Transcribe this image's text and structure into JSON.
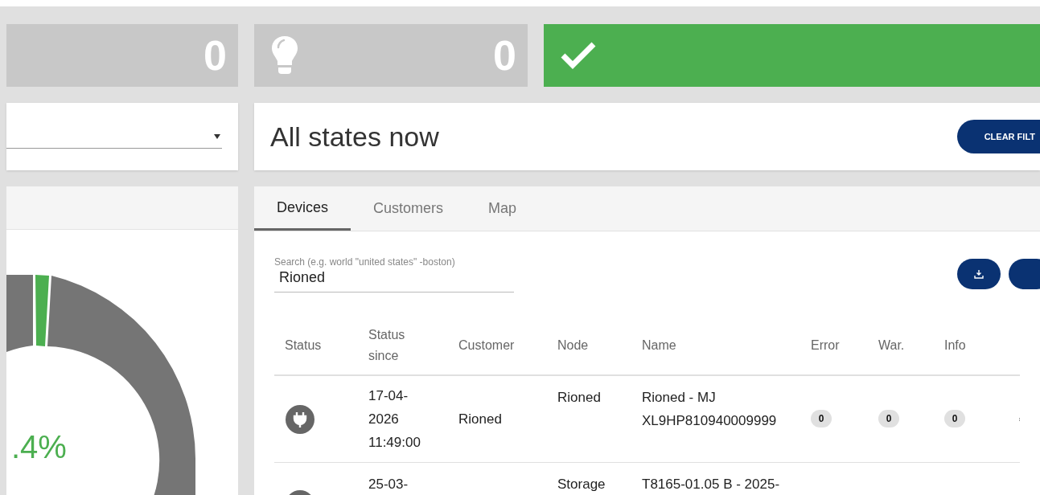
{
  "counters": [
    {
      "kind": "plain",
      "value": "0"
    },
    {
      "kind": "bulb",
      "value": "0"
    },
    {
      "kind": "ok"
    }
  ],
  "filter": {
    "title": "All states now",
    "clear_button": "CLEAR FILT"
  },
  "chart_panel": {
    "percentage": ".4%"
  },
  "tabs": [
    {
      "label": "Devices",
      "selected": true
    },
    {
      "label": "Customers",
      "selected": false
    },
    {
      "label": "Map",
      "selected": false
    }
  ],
  "search": {
    "placeholder": "Search (e.g. world \"united states\" -boston)",
    "value": "Rioned"
  },
  "table": {
    "columns": [
      "Status",
      "Status since",
      "Customer",
      "Node",
      "Name",
      "Error",
      "War.",
      "Info"
    ],
    "rows": [
      {
        "status_since": "17-04-\n2026\n11:49:00",
        "customer": "Rioned",
        "node": "Rioned",
        "name": "Rioned - MJ\nXL9HP810940009999",
        "error": "0",
        "warnings": "0",
        "info": "0"
      },
      {
        "status_since": "25-03-",
        "customer": "",
        "node": "Storage",
        "name": "T8165-01.05 B - 2025-",
        "error": "",
        "warnings": "",
        "info": ""
      }
    ]
  }
}
